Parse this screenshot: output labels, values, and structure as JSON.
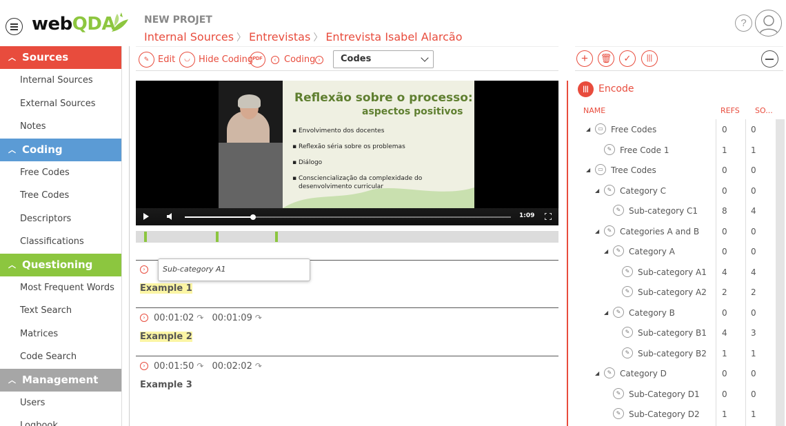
{
  "app": {
    "logo_main": "web",
    "logo_accent": "QDA",
    "project_title": "NEW PROJET",
    "breadcrumb": [
      "Internal Sources",
      "Entrevistas",
      "Entrevista Isabel Alarcão"
    ],
    "help_glyph": "?"
  },
  "sidebar": {
    "sections": [
      {
        "label": "Sources",
        "color": "#e84c3d",
        "items": [
          "Internal Sources",
          "External Sources",
          "Notes"
        ]
      },
      {
        "label": "Coding",
        "color": "#5b9bd5",
        "items": [
          "Free Codes",
          "Tree Codes",
          "Descriptors",
          "Classifications"
        ]
      },
      {
        "label": "Questioning",
        "color": "#8cc63f",
        "items": [
          "Most Frequent Words",
          "Text Search",
          "Matrices",
          "Code Search"
        ]
      },
      {
        "label": "Management",
        "color": "#a6a6a6",
        "items": [
          "Users",
          "Logbook"
        ]
      }
    ]
  },
  "toolbar": {
    "edit_label": "Edit",
    "hide_coding_label": "Hide Coding",
    "pdf_label": "PDF",
    "coding_label": "Coding",
    "select_value": "Codes"
  },
  "video": {
    "slide_title1": "Reflexão sobre o processo:",
    "slide_title2": "aspectos positivos",
    "bullets": [
      "Envolvimento dos docentes",
      "Reflexão séria sobre os problemas",
      "Diálogo",
      "Consciencialização da complexidade do desenvolvimento curricular"
    ],
    "time": "1:09",
    "progress_fraction": 0.21
  },
  "timeline": {
    "marks": [
      0.02,
      0.19,
      0.33
    ]
  },
  "segments": [
    {
      "start": "",
      "end": "",
      "text": "Example 1",
      "highlight": true
    },
    {
      "start": "00:01:02",
      "end": "00:01:09",
      "text": "Example 2",
      "highlight": true
    },
    {
      "start": "00:01:50",
      "end": "00:02:02",
      "text": "Example 3",
      "highlight": false
    }
  ],
  "tooltip": "Sub-category A1",
  "right": {
    "encode_label": "Encode",
    "headers": {
      "name": "NAME",
      "refs": "REFS",
      "sources": "SO..."
    },
    "tree": [
      {
        "label": "Free Codes",
        "level": 0,
        "expander": true,
        "refs": "0",
        "src": "0"
      },
      {
        "label": "Free Code 1",
        "level": 1,
        "expander": false,
        "refs": "1",
        "src": "1"
      },
      {
        "label": "Tree Codes",
        "level": 0,
        "expander": true,
        "refs": "0",
        "src": "0"
      },
      {
        "label": "Category C",
        "level": 1,
        "expander": true,
        "refs": "0",
        "src": "0"
      },
      {
        "label": "Sub-category C1",
        "level": 2,
        "expander": false,
        "refs": "8",
        "src": "4"
      },
      {
        "label": "Categories A and B",
        "level": 1,
        "expander": true,
        "refs": "0",
        "src": "0"
      },
      {
        "label": "Category A",
        "level": 2,
        "expander": true,
        "refs": "0",
        "src": "0"
      },
      {
        "label": "Sub-category A1",
        "level": 3,
        "expander": false,
        "refs": "4",
        "src": "4"
      },
      {
        "label": "Sub-category A2",
        "level": 3,
        "expander": false,
        "refs": "2",
        "src": "2"
      },
      {
        "label": "Category B",
        "level": 2,
        "expander": true,
        "refs": "0",
        "src": "0"
      },
      {
        "label": "Sub-category B1",
        "level": 3,
        "expander": false,
        "refs": "4",
        "src": "3"
      },
      {
        "label": "Sub-category B2",
        "level": 3,
        "expander": false,
        "refs": "1",
        "src": "1"
      },
      {
        "label": "Category D",
        "level": 1,
        "expander": true,
        "refs": "0",
        "src": "0"
      },
      {
        "label": "Sub-Category D1",
        "level": 2,
        "expander": false,
        "refs": "0",
        "src": "0"
      },
      {
        "label": "Sub-Category D2",
        "level": 2,
        "expander": false,
        "refs": "1",
        "src": "1"
      }
    ]
  }
}
